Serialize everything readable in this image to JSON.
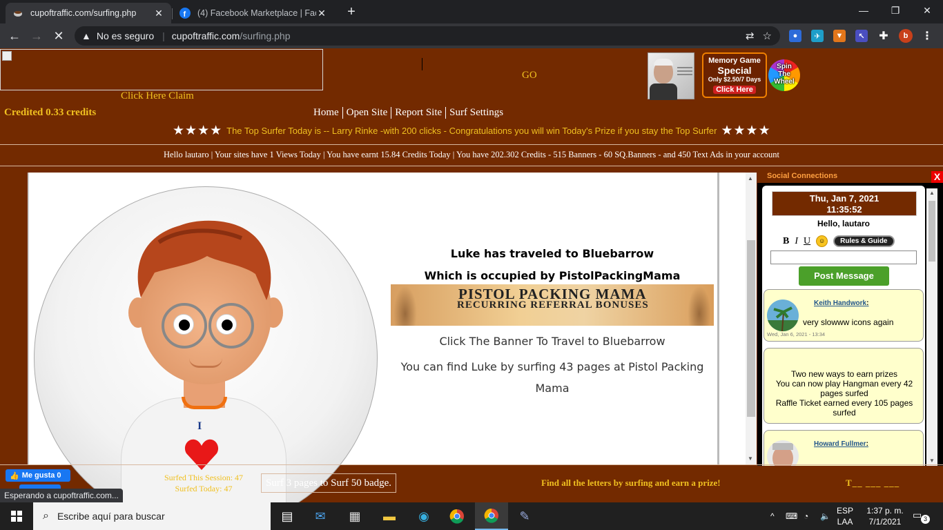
{
  "browser": {
    "tabs": [
      {
        "title": "cupoftraffic.com/surfing.php",
        "active": true
      },
      {
        "title": "(4) Facebook Marketplace | Facebook",
        "active": false
      }
    ],
    "not_secure_label": "No es seguro",
    "url_host": "cupoftraffic.com",
    "url_path": "/surfing.php",
    "status_text": "Esperando a cupoftraffic.com..."
  },
  "header": {
    "claim_text": "Click Here Claim",
    "go_label": "GO",
    "memory_ad": {
      "line1": "Memory Game",
      "line2": "Special",
      "line3": "Only $2.50/7 Days",
      "cta": "Click Here"
    },
    "spin_wheel": [
      "Spin",
      "The",
      "Wheel"
    ],
    "credited": "Credited 0.33 credits",
    "nav": [
      "Home",
      "Open Site",
      "Report Site",
      "Surf Settings"
    ],
    "stars": "★★★★",
    "top_surfer": "The Top Surfer Today is -- Larry Rinke -with 200 clicks - Congratulations you will win Today's Prize if you stay the Top Surfer",
    "hello_line": "Hello lautaro | Your sites have 1 Views Today | You have earnt 15.84 Credits Today | You have 202.302 Credits - 515 Banners - 60 SQ.Banners - and 450 Text Ads in your account"
  },
  "story": {
    "line1": "Luke has traveled to Bluebarrow",
    "line2": "Which is occupied by PistolPackingMama",
    "banner_title": "PISTOL PACKING MAMA",
    "banner_sub": "RECURRING REFERRAL BONUSES",
    "line3": "Click The Banner To Travel to Bluebarrow",
    "line4": "You can find Luke by surfing 43 pages at Pistol Packing Mama",
    "shirt_letter": "I"
  },
  "social": {
    "header": "Social Connections",
    "close": "X",
    "clock_date": "Thu, Jan 7, 2021",
    "clock_time": "11:35:52",
    "hello": "Hello, lautaro",
    "fmt": [
      "B",
      "I",
      "U"
    ],
    "rules_label": "Rules & Guide",
    "post_label": "Post Message",
    "messages": [
      {
        "name": "Keith Handwork",
        "text": "very slowww icons again",
        "date": "Wed, Jan 6, 2021 - 13:34"
      },
      {
        "system": [
          "Two new ways to earn prizes",
          "You can now play Hangman every 42",
          "pages surfed",
          "Raffle Ticket earned every 105 pages",
          "surfed"
        ]
      },
      {
        "name": "Howard Fullmer",
        "text": "",
        "date": ""
      }
    ]
  },
  "footer": {
    "like_label": "Me gusta 0",
    "surfed_session": "Surfed This Session: 47",
    "surfed_today": "Surfed Today: 47",
    "badge_text": "Surf 3 pages to Surf 50 badge.",
    "find_letters": "Find all the letters by surfing and earn a prize!",
    "letters": "T__ ___ ___"
  },
  "taskbar": {
    "search_placeholder": "Escribe aquí para buscar",
    "lang1": "ESP",
    "lang2": "LAA",
    "time": "1:37 p. m.",
    "date": "7/1/2021",
    "notifications": "3"
  }
}
